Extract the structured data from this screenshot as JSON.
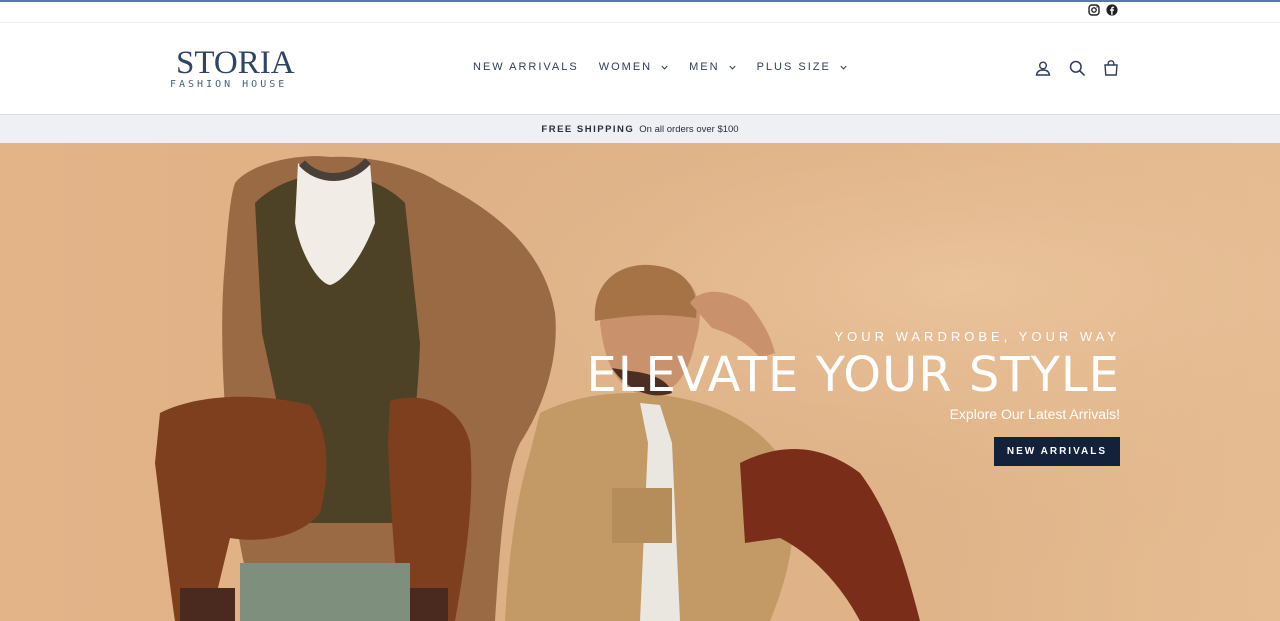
{
  "social": {
    "instagram_icon": "instagram-icon",
    "facebook_icon": "facebook-icon"
  },
  "brand": {
    "name": "STORIA",
    "tagline": "FASHION HOUSE"
  },
  "nav": {
    "items": [
      {
        "label": "NEW ARRIVALS",
        "has_dropdown": false
      },
      {
        "label": "WOMEN",
        "has_dropdown": true
      },
      {
        "label": "MEN",
        "has_dropdown": true
      },
      {
        "label": "PLUS SIZE",
        "has_dropdown": true
      }
    ]
  },
  "header_icons": [
    "account-icon",
    "search-icon",
    "cart-icon"
  ],
  "promo": {
    "headline": "FREE SHIPPING",
    "detail": "On all orders over $100"
  },
  "hero": {
    "kicker": "YOUR WARDROBE, YOUR WAY",
    "title": "ELEVATE YOUR STYLE",
    "subtitle": "Explore Our Latest Arrivals!",
    "cta_label": "NEW ARRIVALS"
  },
  "colors": {
    "accent": "#13213a",
    "nav_text": "#2e3e5c",
    "hero_bg": "#deb085",
    "promo_bg": "#eef0f3"
  }
}
